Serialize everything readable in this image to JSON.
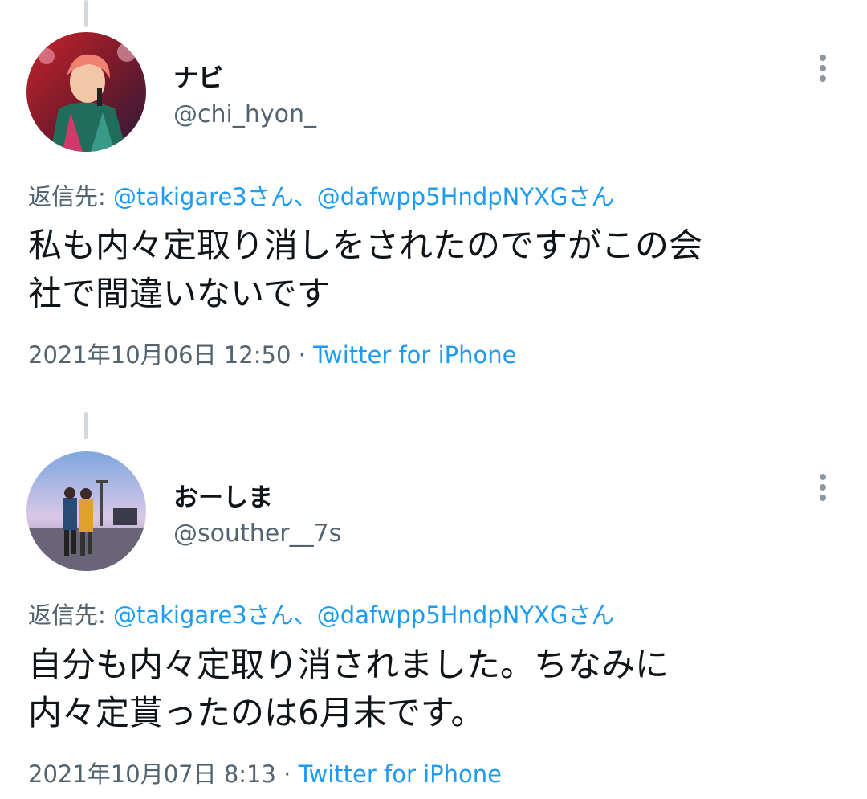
{
  "tweets": [
    {
      "display_name": "ナビ",
      "handle": "@chi_hyon_",
      "reply_prefix": "返信先: ",
      "reply_mention_1": "@takigare3さん",
      "reply_separator": "、",
      "reply_mention_2": "@dafwpp5HndpNYXGさん",
      "body": "私も内々定取り消しをされたのですがこの会\n社で間違いないです",
      "timestamp": "2021年10月06日 12:50",
      "meta_separator": " · ",
      "source": "Twitter for iPhone",
      "avatar_icon": "user-avatar-performer-photo",
      "more_icon": "more-options-vertical-dots-icon"
    },
    {
      "display_name": "おーしま",
      "handle": "@souther__7s",
      "reply_prefix": "返信先: ",
      "reply_mention_1": "@takigare3さん",
      "reply_separator": "、",
      "reply_mention_2": "@dafwpp5HndpNYXGさん",
      "body": "自分も内々定取り消されました。ちなみに\n内々定貰ったのは6月末です。",
      "timestamp": "2021年10月07日 8:13",
      "meta_separator": " · ",
      "source": "Twitter for iPhone",
      "avatar_icon": "user-avatar-couple-photo",
      "more_icon": "more-options-vertical-dots-icon"
    }
  ],
  "colors": {
    "link": "#1d9bf0",
    "secondary_text": "#536471",
    "primary_text": "#0f1419",
    "thread_line": "#cfd9de",
    "divider": "#e1e8ed"
  }
}
